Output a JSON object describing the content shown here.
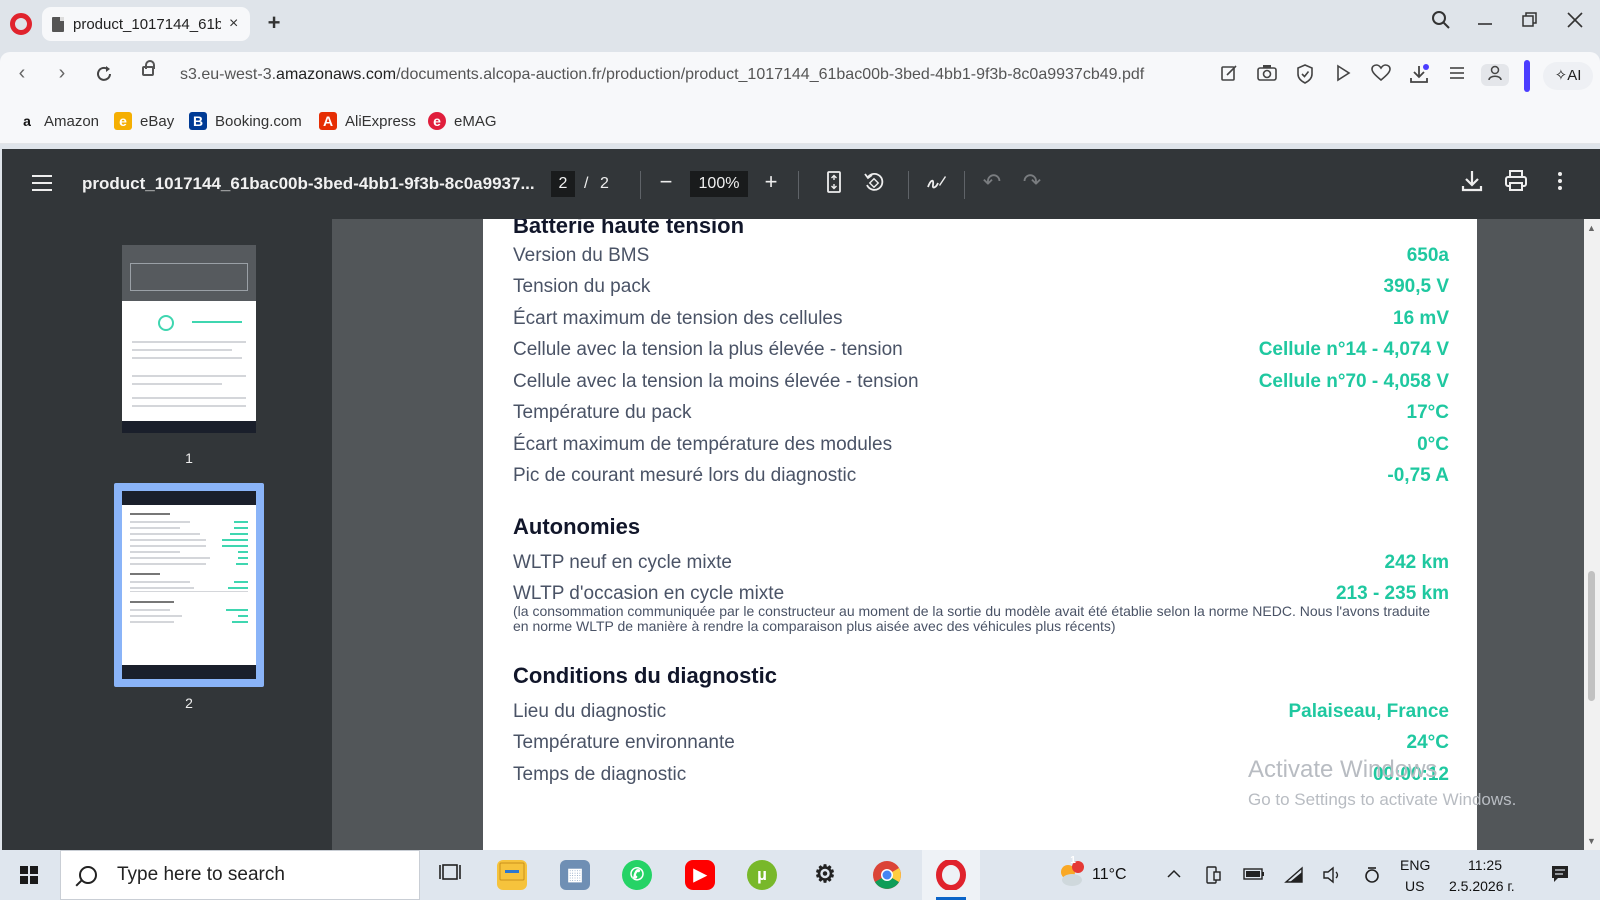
{
  "browser": {
    "tab_title": "product_1017144_61b",
    "tab_close": "×",
    "new_tab": "+",
    "url_host_prefix": "s3.eu-west-3.",
    "url_host": "amazonaws.com",
    "url_path": "/documents.alcopa-auction.fr/production/product_1017144_61bac00b-3bed-4bb1-9f3b-8c0a9937cb49.pdf",
    "ai_label": "AI",
    "bookmarks": [
      {
        "label": "Amazon",
        "glyph": "a",
        "color": "#ffffff"
      },
      {
        "label": "eBay",
        "glyph": "e",
        "color": "#f5af02"
      },
      {
        "label": "Booking.com",
        "glyph": "B",
        "color": "#003b95"
      },
      {
        "label": "AliExpress",
        "glyph": "A",
        "color": "#e62e04"
      },
      {
        "label": "eMAG",
        "glyph": "e",
        "color": "#e01e3c"
      }
    ]
  },
  "viewer": {
    "title": "product_1017144_61bac00b-3bed-4bb1-9f3b-8c0a9937...",
    "current_page": "2",
    "page_sep": "/",
    "total_pages": "2",
    "zoom": "100%",
    "thumbnails": [
      {
        "label": "1"
      },
      {
        "label": "2"
      }
    ]
  },
  "document": {
    "battery": {
      "title": "Batterie haute tension",
      "rows": [
        {
          "label": "Version du BMS",
          "value": "650a"
        },
        {
          "label": "Tension du pack",
          "value": "390,5 V"
        },
        {
          "label": "Écart maximum de tension des cellules",
          "value": "16 mV"
        },
        {
          "label": "Cellule avec la tension la plus élevée - tension",
          "value": "Cellule n°14 - 4,074 V"
        },
        {
          "label": "Cellule avec la tension la moins élevée - tension",
          "value": "Cellule n°70 - 4,058 V"
        },
        {
          "label": "Température du pack",
          "value": "17°C"
        },
        {
          "label": "Écart maximum de température des modules",
          "value": "0°C"
        },
        {
          "label": "Pic de courant mesuré lors du diagnostic",
          "value": "-0,75 A"
        }
      ]
    },
    "autonomies": {
      "title": "Autonomies",
      "rows": [
        {
          "label": "WLTP neuf en cycle mixte",
          "value": "242 km"
        },
        {
          "label": "WLTP d'occasion en cycle mixte",
          "value": "213 - 235 km"
        }
      ],
      "note": "(la consommation communiquée par le constructeur au moment de la sortie du modèle avait été établie selon la norme NEDC. Nous l'avons traduite en norme WLTP de manière à rendre la comparaison plus aisée avec des véhicules plus récents)"
    },
    "conditions": {
      "title": "Conditions du diagnostic",
      "rows": [
        {
          "label": "Lieu du diagnostic",
          "value": "Palaiseau, France"
        },
        {
          "label": "Température environnante",
          "value": "24°C"
        },
        {
          "label": "Temps de diagnostic",
          "value": "00:00:12"
        }
      ]
    }
  },
  "watermark": {
    "line1": "Activate Windows",
    "line2": "Go to Settings to activate Windows."
  },
  "taskbar": {
    "search_placeholder": "Type here to search",
    "weather": "11°C",
    "weather_badge": "1",
    "lang_top": "ENG",
    "lang_bottom": "US",
    "time": "11:25",
    "date": "2.5.2026 г."
  },
  "colors": {
    "accent_value": "#1fc8a0",
    "heading": "#11162a",
    "label": "#4a5366",
    "viewer_toolbar": "#323639"
  }
}
